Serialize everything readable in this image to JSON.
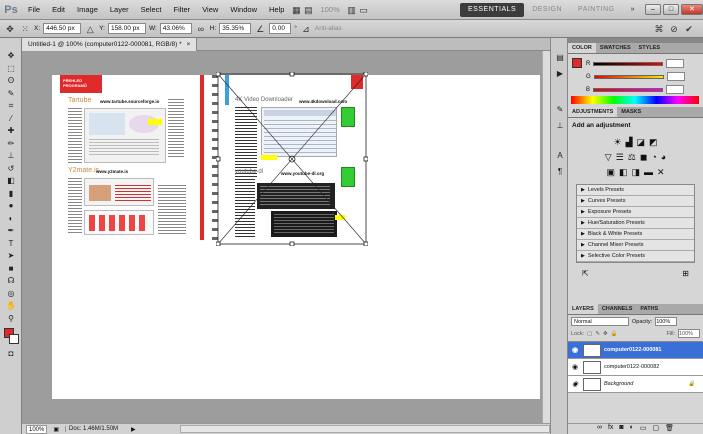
{
  "app": {
    "logo": "Ps",
    "menu": [
      "File",
      "Edit",
      "Image",
      "Layer",
      "Select",
      "Filter",
      "View",
      "Window",
      "Help"
    ],
    "zoom_menu": "100%",
    "workspaces": {
      "essentials": "ESSENTIALS",
      "design": "DESIGN",
      "painting": "PAINTING",
      "more": "»"
    }
  },
  "options": {
    "x_label": "X:",
    "x_value": "446.50 px",
    "y_label": "Y:",
    "y_value": "158.00 px",
    "w_label": "W:",
    "w_value": "43.06%",
    "h_label": "H:",
    "h_value": "35.35%",
    "angle_value": "0.00",
    "angle_unit": "°",
    "antialias": "Anti-alias"
  },
  "document": {
    "tab_title": "Untitled-1 @ 100% (computer0122-000081, RGB/8) *",
    "tab_close": "×",
    "zoom_status": "100%",
    "doc_status": "Doc: 1.46M/1.50M"
  },
  "canvas": {
    "page1_banner": "PŘEHLED PROGRAMŮ",
    "page1_site1": "www.tartube.sourceforge.io",
    "page1_title1": "Tartube",
    "page1_title2": "Y2mate.is",
    "page1_site2": "www.y2mate.is",
    "page2_site1": "www.4kdownload.com",
    "page2_title1": "4K Video Downloader",
    "page2_site2": "www.youtube-dl.org",
    "page2_title2": "youtube-dl"
  },
  "color_panel": {
    "tabs": [
      "COLOR",
      "SWATCHES",
      "STYLES"
    ],
    "channels": [
      {
        "label": "R",
        "color": "#e03030"
      },
      {
        "label": "G",
        "color": "#20a020"
      },
      {
        "label": "B",
        "color": "#2040d0"
      }
    ],
    "fg_color": "#e02a2a"
  },
  "adjustments": {
    "tabs": [
      "ADJUSTMENTS",
      "MASKS"
    ],
    "heading": "Add an adjustment",
    "presets": [
      "Levels Presets",
      "Curves Presets",
      "Exposure Presets",
      "Hue/Saturation Presets",
      "Black & White Presets",
      "Channel Mixer Presets",
      "Selective Color Presets"
    ]
  },
  "layers": {
    "tabs": [
      "LAYERS",
      "CHANNELS",
      "PATHS"
    ],
    "blend_mode": "Normal",
    "opacity_label": "Opacity:",
    "opacity_value": "100%",
    "lock_label": "Lock:",
    "fill_label": "Fill:",
    "fill_value": "100%",
    "items": [
      {
        "name": "computer0122-000081",
        "selected": true
      },
      {
        "name": "computer0122-000082",
        "selected": false
      },
      {
        "name": "Background",
        "selected": false
      }
    ]
  },
  "colors": {
    "accent_red": "#e02a2a",
    "selection_blue": "#3a6fd8",
    "essentials_bg": "#3c3c3c"
  }
}
